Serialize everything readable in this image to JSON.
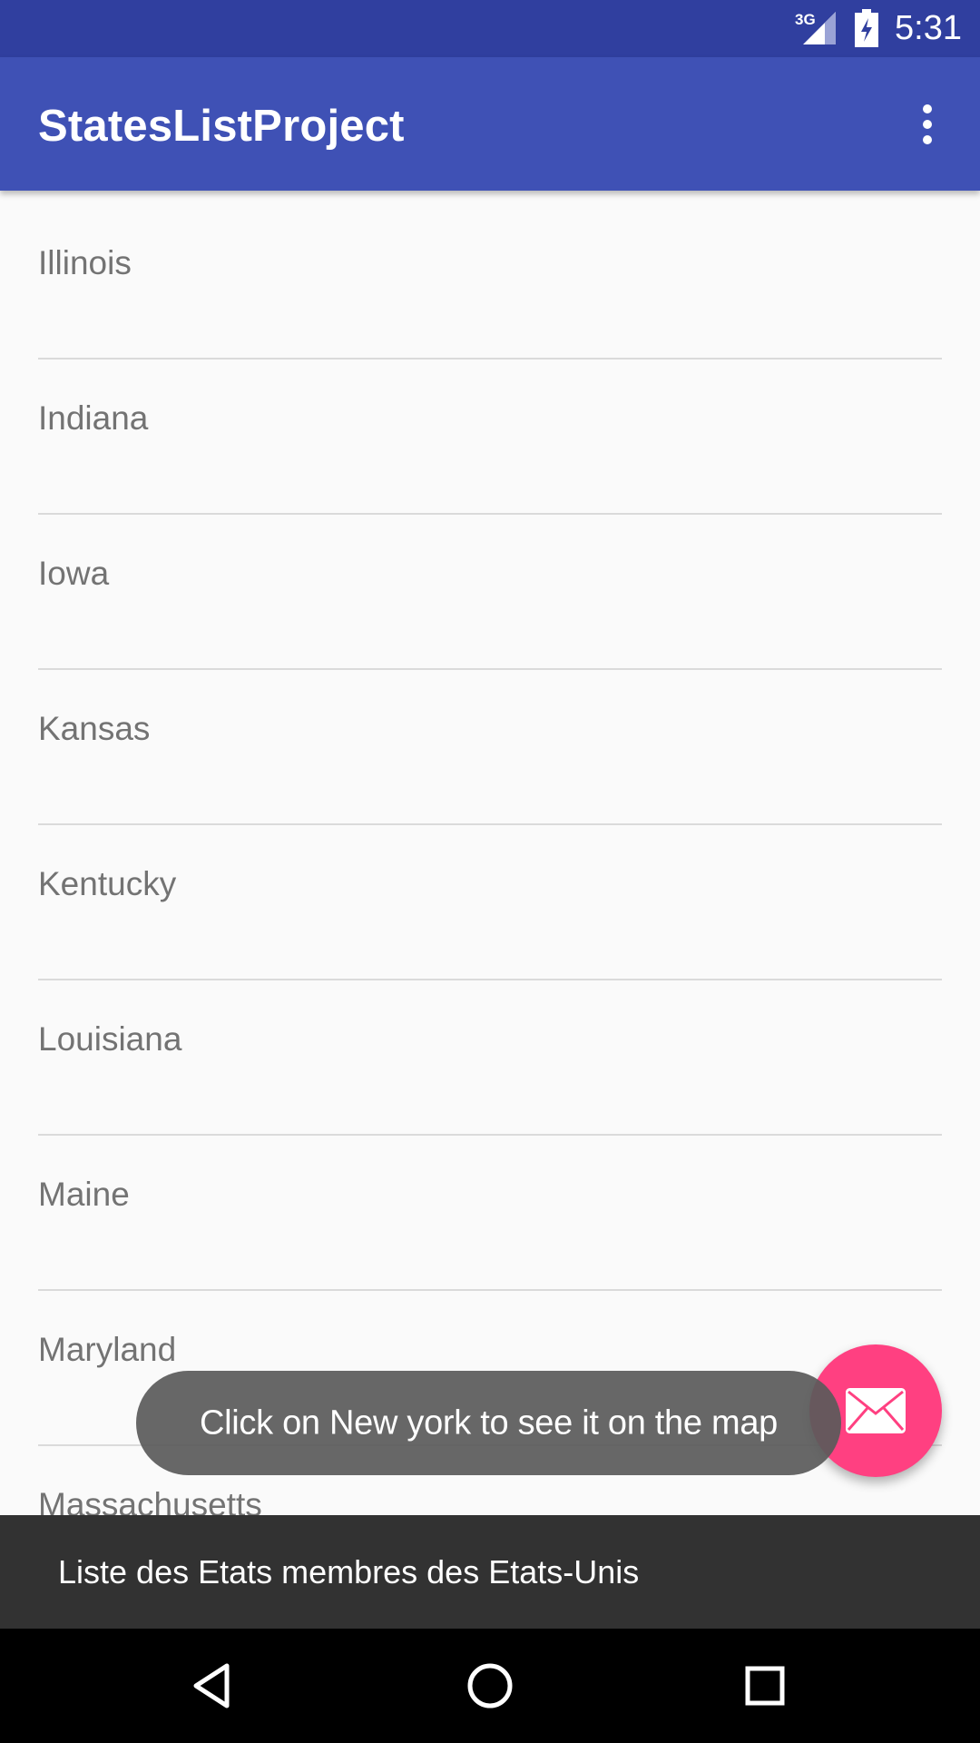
{
  "status_bar": {
    "network": "3G",
    "time": "5:31"
  },
  "app_bar": {
    "title": "StatesListProject",
    "overflow_icon": "more-vert-icon"
  },
  "states": [
    {
      "label": "Illinois"
    },
    {
      "label": "Indiana"
    },
    {
      "label": "Iowa"
    },
    {
      "label": "Kansas"
    },
    {
      "label": "Kentucky"
    },
    {
      "label": "Louisiana"
    },
    {
      "label": "Maine"
    },
    {
      "label": "Maryland"
    },
    {
      "label": "Massachusetts"
    }
  ],
  "toast": {
    "text": "Click on New york to see it on the map"
  },
  "fab": {
    "icon": "mail-icon",
    "color": "#ff4081"
  },
  "snackbar": {
    "text": "Liste des Etats membres des Etats-Unis"
  },
  "nav_bar": {
    "back_icon": "back-triangle-icon",
    "home_icon": "home-circle-icon",
    "recents_icon": "recents-square-icon"
  },
  "colors": {
    "primary": "#3f51b5",
    "primary_dark": "#303f9f",
    "accent": "#ff4081"
  }
}
